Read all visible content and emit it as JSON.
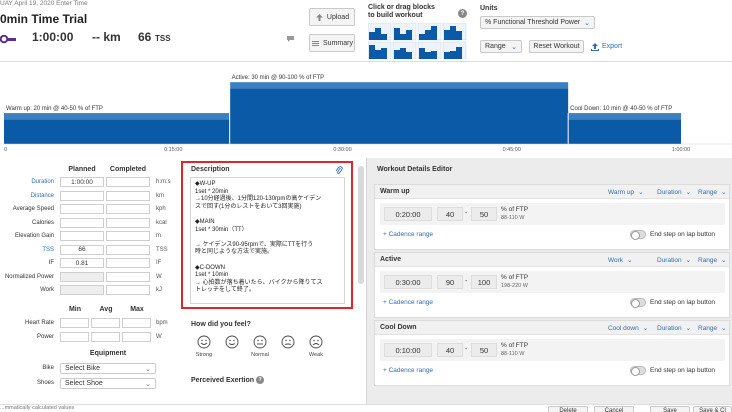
{
  "header": {
    "date_line": "UAY   April 19, 2020   Enter Time",
    "workout_title": "0min Time Trial",
    "duration": "1:00:00",
    "distance": "-- km",
    "tss": "66",
    "tss_unit": "TSS",
    "upload_label": "Upload",
    "summary_label": "Summary",
    "blocks_title_line1": "Click or drag blocks",
    "blocks_title_line2": "to build workout",
    "help_glyph": "?",
    "units_label": "Units",
    "units_value": "% Functional Threshold Power",
    "range_label": "Range",
    "reset_label": "Reset Workout",
    "export_label": "Export"
  },
  "chart": {
    "labels": {
      "warmup": "Warm up: 20 min @ 40-50 % of FTP",
      "active": "Active: 30 min @ 90-100 % of FTP",
      "cooldown": "Cool Down: 10 min @ 40-50 % of FTP"
    },
    "ticks": [
      "0",
      "0:15:00",
      "0:30:00",
      "0:45:00",
      "1:00:00"
    ],
    "color_main": "#0b5aa8",
    "color_band": "#3f7fc0"
  },
  "chart_data": {
    "type": "area",
    "x_unit": "time",
    "segments": [
      {
        "name": "Warm up",
        "start": "0:00:00",
        "end": "0:20:00",
        "low_pct_ftp": 40,
        "high_pct_ftp": 50
      },
      {
        "name": "Active",
        "start": "0:20:00",
        "end": "0:50:00",
        "low_pct_ftp": 90,
        "high_pct_ftp": 100
      },
      {
        "name": "Cool Down",
        "start": "0:50:00",
        "end": "1:00:00",
        "low_pct_ftp": 40,
        "high_pct_ftp": 50
      }
    ],
    "x_ticks": [
      "0",
      "0:15:00",
      "0:30:00",
      "0:45:00",
      "1:00:00"
    ],
    "xlim_minutes": [
      0,
      60
    ]
  },
  "planned": {
    "col_planned": "Planned",
    "col_completed": "Completed",
    "rows": [
      {
        "label": "Duration",
        "planned": "1:00:00",
        "unit": "h:m:s",
        "link": true
      },
      {
        "label": "Distance",
        "planned": "",
        "unit": "km",
        "link": true
      },
      {
        "label": "Average Speed",
        "planned": "",
        "unit": "kph",
        "link": false
      },
      {
        "label": "Calories",
        "planned": "",
        "unit": "kcal",
        "link": false
      },
      {
        "label": "Elevation Gain",
        "planned": "",
        "unit": "m",
        "link": false
      },
      {
        "label": "TSS",
        "planned": "66",
        "unit": "TSS",
        "link": true
      },
      {
        "label": "IF",
        "planned": "0.81",
        "unit": "IF",
        "link": false
      },
      {
        "label": "Normalized Power",
        "planned": "",
        "unit": "W",
        "link": false
      },
      {
        "label": "Work",
        "planned": "",
        "unit": "kJ",
        "link": false
      }
    ],
    "min_label": "Min",
    "avg_label": "Avg",
    "max_label": "Max",
    "hr_label": "Heart Rate",
    "hr_unit": "bpm",
    "power_label": "Power",
    "power_unit": "W",
    "equipment_label": "Equipment",
    "bike_label": "Bike",
    "bike_value": "Select Bike",
    "shoes_label": "Shoes",
    "shoes_value": "Select Shoe"
  },
  "description": {
    "title": "Description",
    "lines": [
      "◆W-UP",
      "1set * 20min",
      "→10分経過後、1分間120-130rpmの高ケイデン",
      "スで回す(1分のレストをおいて3回実施)",
      "",
      "◆MAIN",
      "1set * 30min（TT）",
      "",
      "→ ケイデンス90-95rpmで、実際にTTを行う",
      "時と同じような方法で実施。",
      "",
      "◆C-DOWN",
      "1set * 10min",
      "→ 心拍数が落ち着いたら、バイクから降りてス",
      "トレッチをして終了。"
    ],
    "feel_title": "How did you feel?",
    "feel_options": [
      "Strong",
      "",
      "Normal",
      "",
      "Weak"
    ],
    "perceived_title": "Perceived Exertion",
    "perceived_help": "?"
  },
  "editor": {
    "title": "Workout Details Editor",
    "cadence_label": "+ Cadence range",
    "end_step_label": "End step on lap button",
    "ftp_label": "% of FTP",
    "sections": [
      {
        "title": "Warm up",
        "type": "Warm up",
        "by": "Duration",
        "mode": "Range",
        "time": "0:20:00",
        "low": "40",
        "high": "50",
        "watts": "88-110 W"
      },
      {
        "title": "Active",
        "type": "Work",
        "by": "Duration",
        "mode": "Range",
        "time": "0:30:00",
        "low": "90",
        "high": "100",
        "watts": "198-220 W"
      },
      {
        "title": "Cool Down",
        "type": "Cool down",
        "by": "Duration",
        "mode": "Range",
        "time": "0:10:00",
        "low": "40",
        "high": "50",
        "watts": "88-110 W"
      }
    ]
  },
  "footer": {
    "note": "...mmatically calculated values",
    "buttons": [
      "Delete",
      "Cancel",
      "Save",
      "Save & Cl"
    ]
  }
}
